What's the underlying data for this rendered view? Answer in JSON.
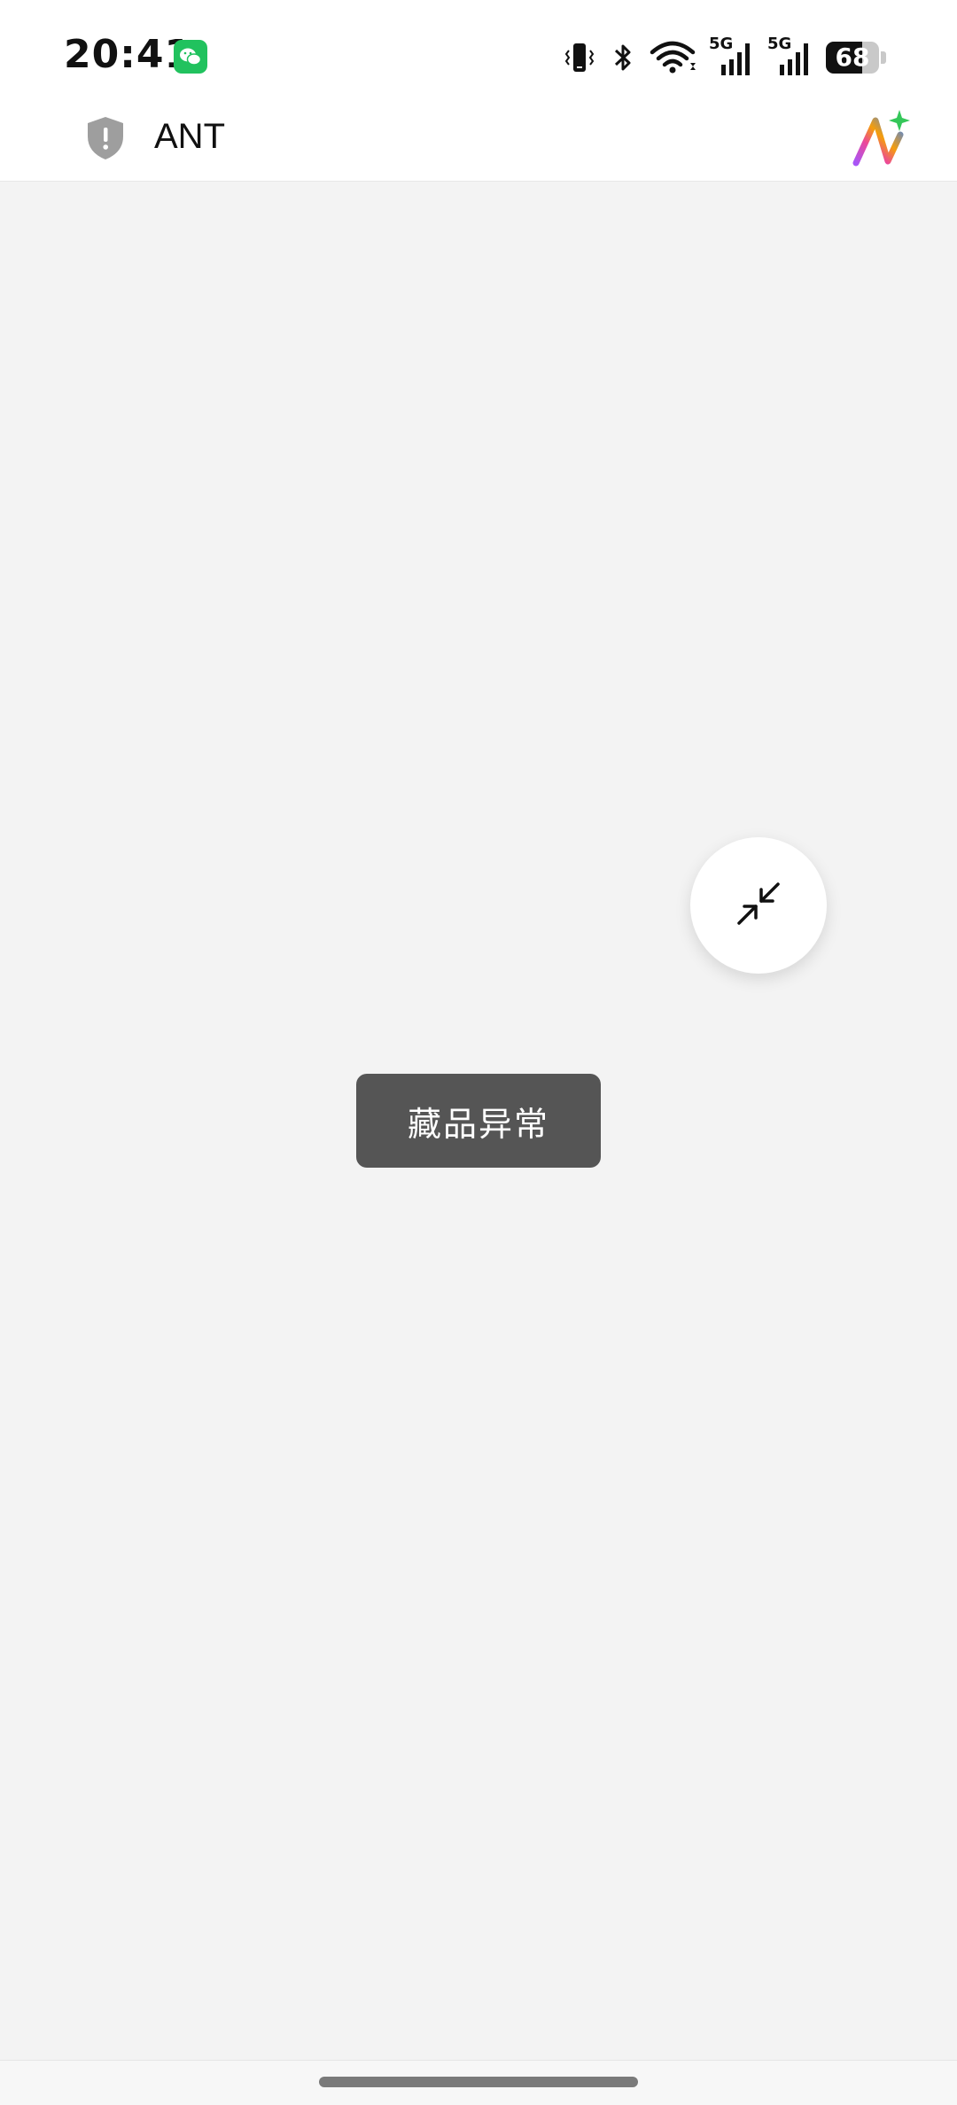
{
  "status_bar": {
    "time": "20:41",
    "network_1": "5G",
    "network_2": "5G",
    "battery_percent": 68,
    "battery_label": "68",
    "icons": [
      "wechat-icon",
      "vibrate-icon",
      "bluetooth-icon",
      "wifi-icon",
      "signal-icon",
      "battery-icon"
    ]
  },
  "header": {
    "title": "ANT",
    "shield_icon": "shield-alert-icon",
    "logo_icon": "ai-sparkle-icon"
  },
  "float_button": {
    "icon": "collapse-arrows-icon"
  },
  "toast": {
    "message": "藏品异常"
  },
  "colors": {
    "background": "#f3f3f3",
    "toast_bg": "#555555",
    "wechat_green": "#21c25e"
  }
}
